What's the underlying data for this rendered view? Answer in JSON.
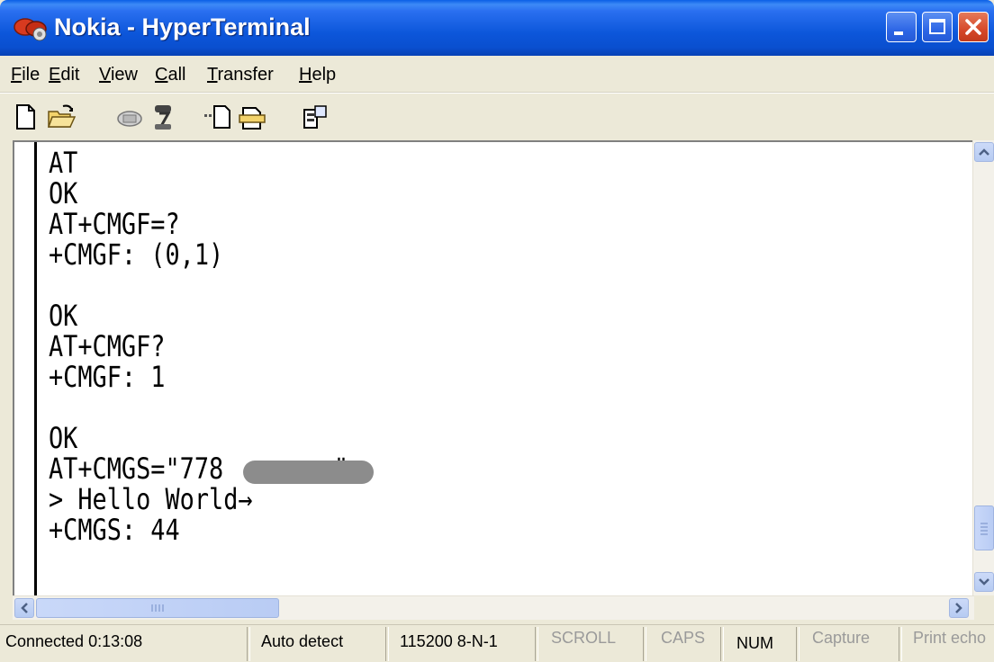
{
  "window": {
    "title": "Nokia - HyperTerminal"
  },
  "menubar": {
    "items": [
      "File",
      "Edit",
      "View",
      "Call",
      "Transfer",
      "Help"
    ]
  },
  "toolbar": {
    "icons": [
      "new-icon",
      "open-icon",
      "disconnect-icon",
      "hangup-icon",
      "send-icon",
      "receive-icon",
      "properties-icon"
    ]
  },
  "terminal": {
    "lines": [
      "AT",
      "OK",
      "AT+CMGF=?",
      "+CMGF: (0,1)",
      "",
      "OK",
      "AT+CMGF?",
      "+CMGF: 1",
      "",
      "OK",
      "AT+CMGS=\"778",
      "> Hello World→",
      "+CMGS: 44"
    ],
    "line_10_suffix": "\""
  },
  "statusbar": {
    "connected": "Connected 0:13:08",
    "detect": "Auto detect",
    "port": "115200 8-N-1",
    "scroll": "SCROLL",
    "caps": "CAPS",
    "num": "NUM",
    "capture": "Capture",
    "print_echo": "Print echo"
  }
}
